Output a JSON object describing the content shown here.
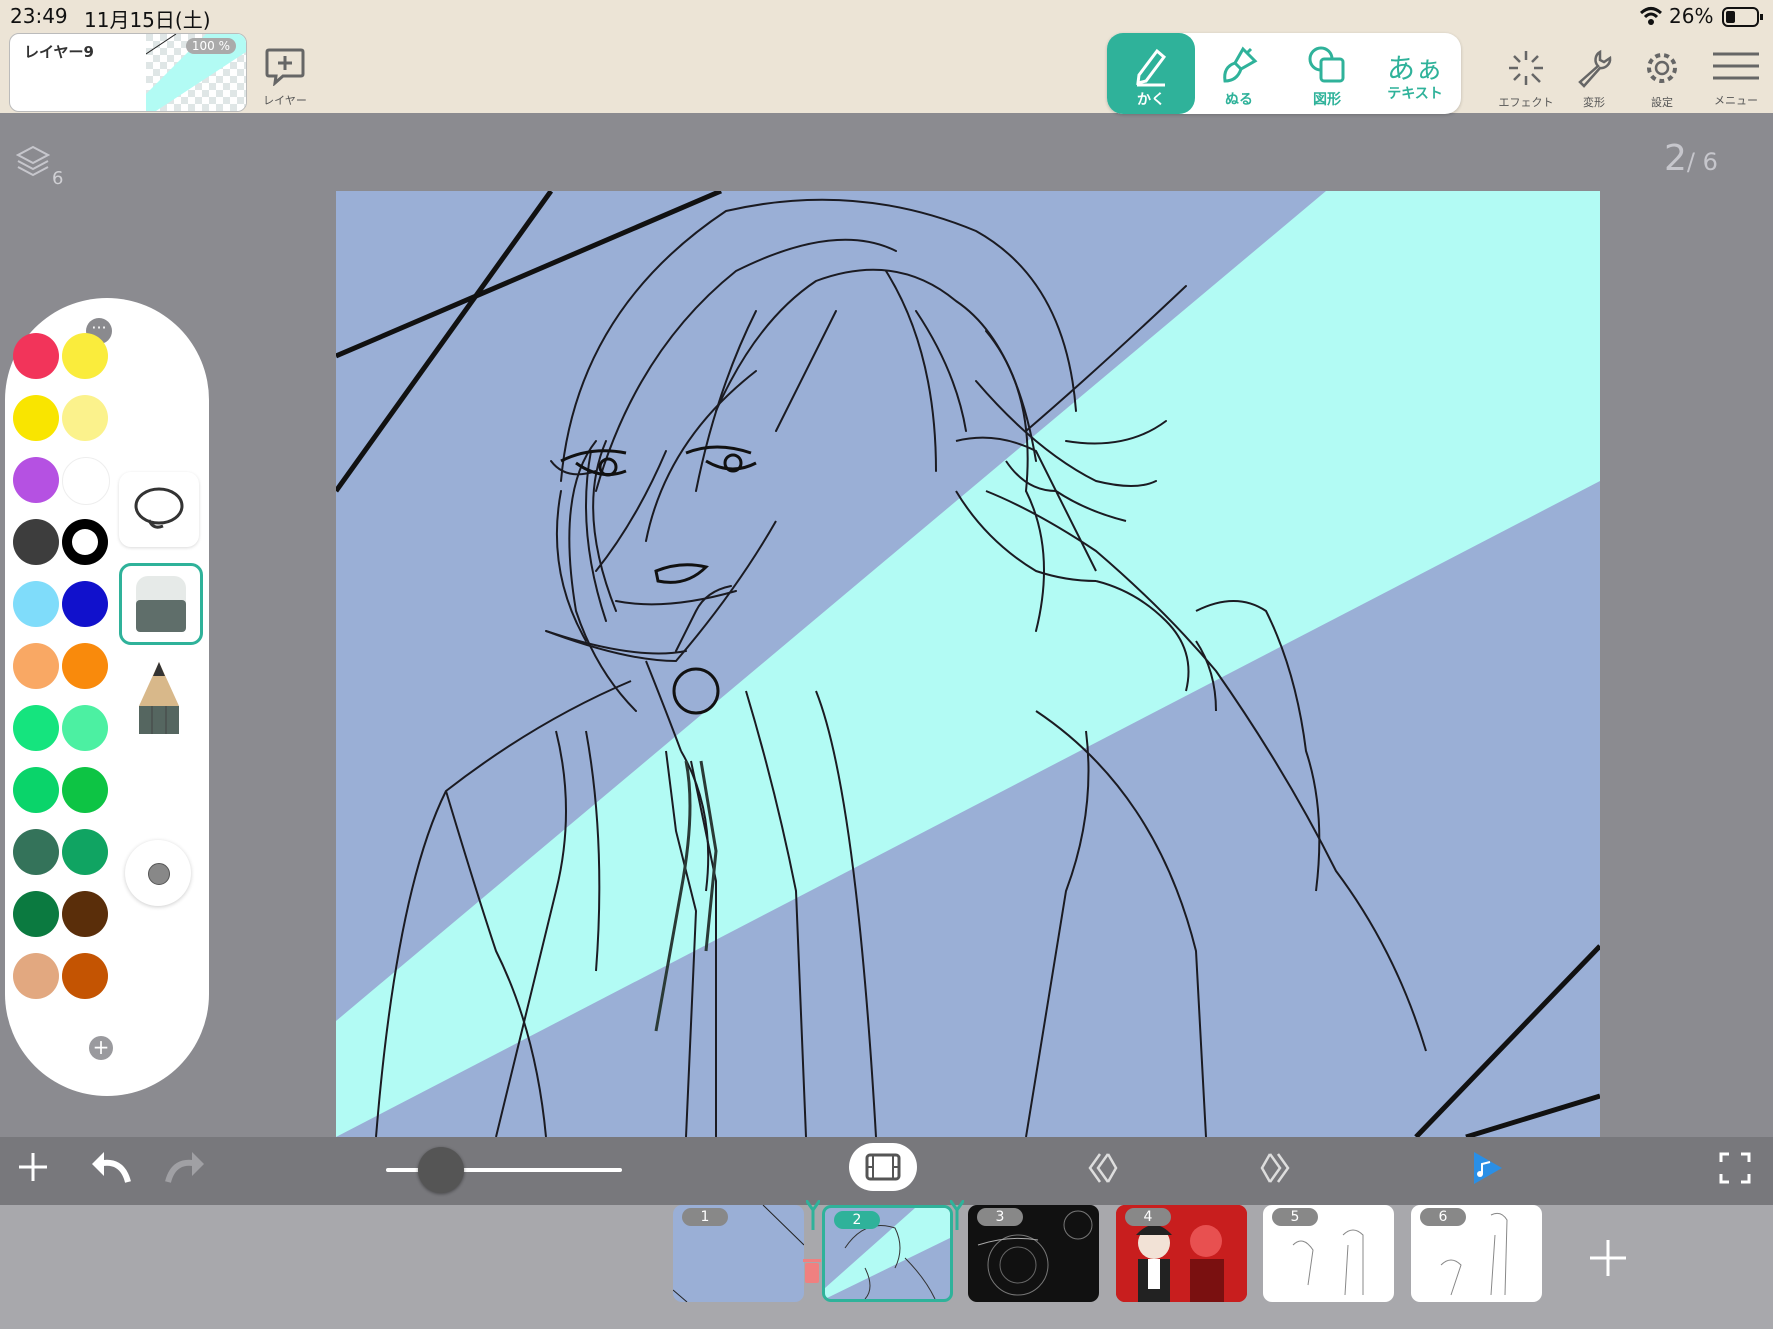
{
  "status_bar": {
    "time": "23:49",
    "date": "11月15日(土)",
    "battery": "26%"
  },
  "layer": {
    "name": "レイヤー9",
    "opacity": "100 %",
    "add_label": "レイヤー"
  },
  "tools": [
    {
      "label": "かく",
      "icon": "pen-icon",
      "active": true
    },
    {
      "label": "ぬる",
      "icon": "brush-icon",
      "active": false
    },
    {
      "label": "図形",
      "icon": "shapes-icon",
      "active": false
    },
    {
      "label": "テキスト",
      "glyph": "あぁ",
      "icon": "text-icon",
      "active": false
    }
  ],
  "right_tools": [
    {
      "label": "エフェクト",
      "icon": "effect-icon"
    },
    {
      "label": "変形",
      "icon": "wrench-icon"
    },
    {
      "label": "設定",
      "icon": "gear-icon"
    },
    {
      "label": "メニュー",
      "icon": "menu-icon"
    }
  ],
  "layer_count": "6",
  "page": {
    "current": "2",
    "total": "/ 6"
  },
  "palette_colors": [
    "#f2345a",
    "#faec3c",
    "#f9e500",
    "#fbf28c",
    "#b551e2",
    "#ffffff",
    "#3d3d3d",
    "#000000",
    "#7fdcfa",
    "#1111cc",
    "#f9a864",
    "#f98a0c",
    "#15e47e",
    "#4cf0a2",
    "#0ad46a",
    "#0dc444",
    "#34735a",
    "#10a462",
    "#0b7a40",
    "#5a2e0a",
    "#e2a880",
    "#c45402"
  ],
  "frames": [
    {
      "num": "1",
      "style": "blue"
    },
    {
      "num": "2",
      "style": "active"
    },
    {
      "num": "3",
      "style": "dark"
    },
    {
      "num": "4",
      "style": "red"
    },
    {
      "num": "5",
      "style": "white"
    },
    {
      "num": "6",
      "style": "white"
    }
  ],
  "colors": {
    "accent": "#2fb29a",
    "canvas_bg": "#9aafd6",
    "light_beam": "#b2fbf4"
  }
}
